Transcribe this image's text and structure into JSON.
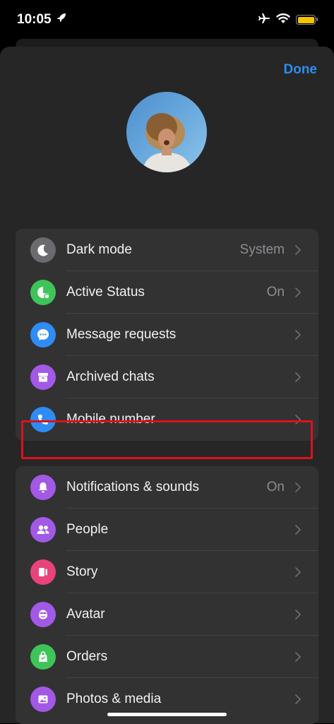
{
  "status_bar": {
    "time": "10:05"
  },
  "header": {
    "done_label": "Done"
  },
  "group1": [
    {
      "label": "Dark mode",
      "value": "System",
      "icon": "moon-icon",
      "color": "#6b6b6f"
    },
    {
      "label": "Active Status",
      "value": "On",
      "icon": "active-status-icon",
      "color": "#3fc45a"
    },
    {
      "label": "Message requests",
      "value": "",
      "icon": "chat-bubble-icon",
      "color": "#2e8cf4"
    },
    {
      "label": "Archived chats",
      "value": "",
      "icon": "archive-icon",
      "color": "#a259e6"
    },
    {
      "label": "Mobile number",
      "value": "",
      "icon": "phone-icon",
      "color": "#2e8cf4"
    }
  ],
  "group2": [
    {
      "label": "Notifications & sounds",
      "value": "On",
      "icon": "bell-icon",
      "color": "#a259e6"
    },
    {
      "label": "People",
      "value": "",
      "icon": "people-icon",
      "color": "#a259e6"
    },
    {
      "label": "Story",
      "value": "",
      "icon": "story-icon",
      "color": "#e8437b"
    },
    {
      "label": "Avatar",
      "value": "",
      "icon": "avatar-face-icon",
      "color": "#a259e6"
    },
    {
      "label": "Orders",
      "value": "",
      "icon": "shopping-bag-icon",
      "color": "#3fc45a"
    },
    {
      "label": "Photos & media",
      "value": "",
      "icon": "photo-icon",
      "color": "#a259e6"
    }
  ]
}
